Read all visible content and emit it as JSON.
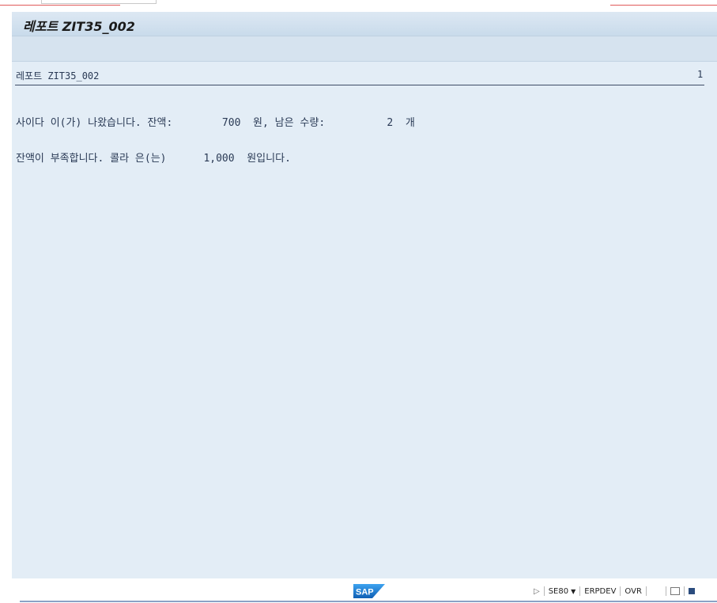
{
  "window": {
    "title": "레포트 ZIT35_002"
  },
  "report": {
    "header_title": "레포트 ZIT35_002",
    "page_number": "1",
    "lines": [
      "사이다 이(가) 나왔습니다. 잔액:        700  원, 남은 수량:          2  개",
      "잔액이 부족합니다. 콜라 은(는)      1,000  원입니다."
    ]
  },
  "status_bar": {
    "logo_text": "SAP",
    "transaction": "SE80",
    "system": "ERPDEV",
    "mode": "OVR"
  },
  "colors": {
    "title_bar": "#d2e1ee",
    "content_bg": "#e3edf6",
    "text": "#2a3a55",
    "sap_blue": "#1f7ed6"
  },
  "icons": {
    "status_arrow": "play-triangle-icon",
    "transaction_dropdown": "chevron-down-icon",
    "connection": "monitor-icon",
    "layout": "layout-icon"
  }
}
